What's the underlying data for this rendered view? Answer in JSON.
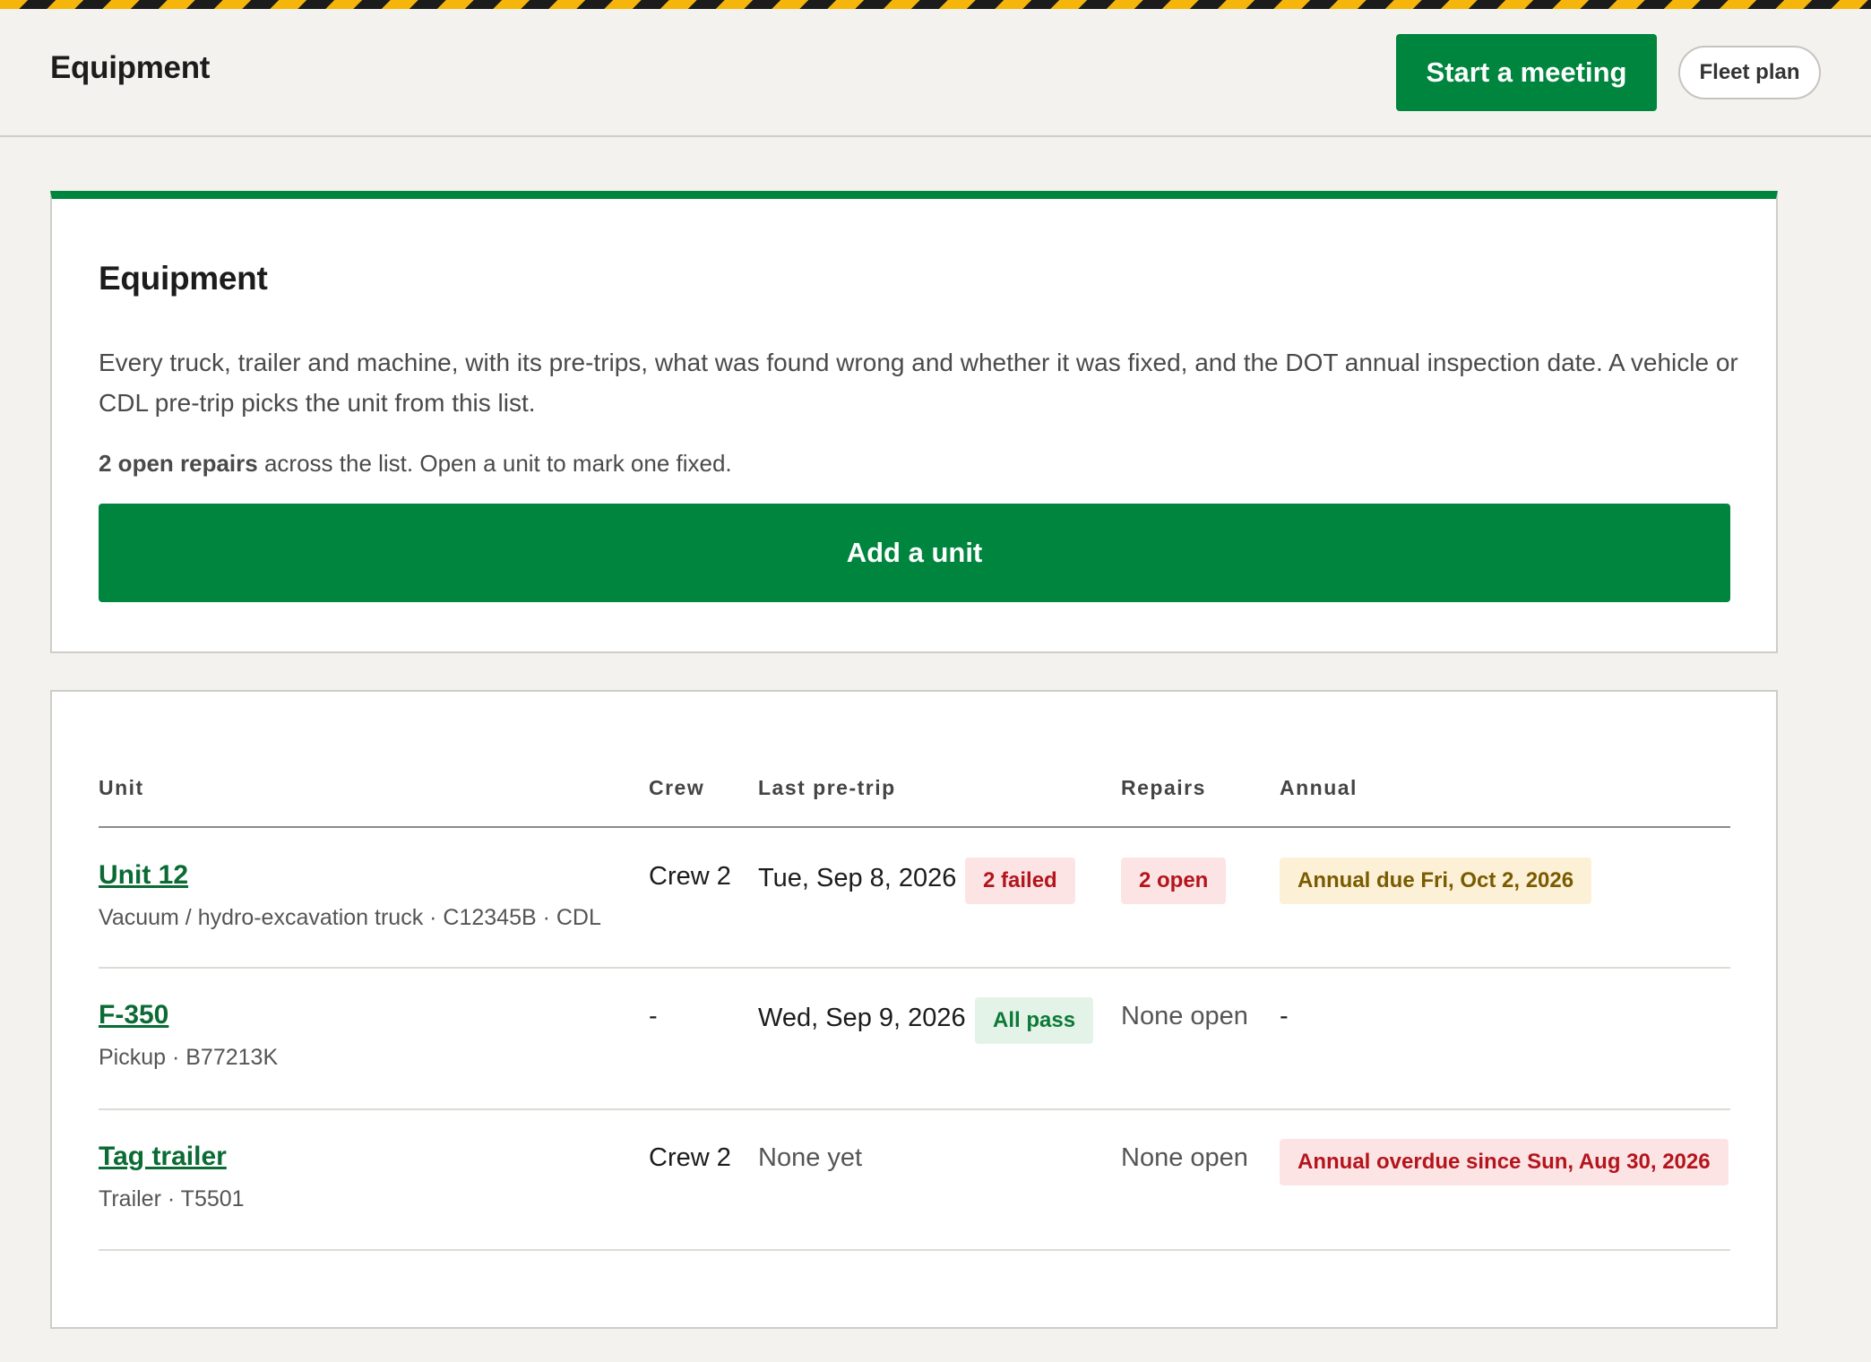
{
  "header": {
    "title": "Equipment",
    "start_meeting_label": "Start a meeting",
    "fleet_plan_label": "Fleet plan"
  },
  "intro": {
    "title": "Equipment",
    "description": "Every truck, trailer and machine, with its pre-trips, what was found wrong and whether it was fixed, and the DOT annual inspection date. A vehicle or CDL pre-trip picks the unit from this list.",
    "repairs_count": "2 open repairs",
    "repairs_note": " across the list. Open a unit to mark one fixed.",
    "add_unit_label": "Add a unit"
  },
  "table": {
    "columns": [
      "Unit",
      "Crew",
      "Last pre-trip",
      "Repairs",
      "Annual"
    ],
    "rows": [
      {
        "unit": "Unit 12",
        "details": "Vacuum / hydro-excavation truck · C12345B · CDL",
        "crew": "Crew 2",
        "last_pretrip": "Tue, Sep 8, 2026",
        "pretrip_badge": "2 failed",
        "repairs": "2 open",
        "annual": "Annual due Fri, Oct 2, 2026"
      },
      {
        "unit": "F-350",
        "details": "Pickup · B77213K",
        "crew": "-",
        "last_pretrip": "Wed, Sep 9, 2026",
        "pretrip_badge": "All pass",
        "repairs": "None open",
        "annual": "-"
      },
      {
        "unit": "Tag trailer",
        "details": "Trailer · T5501",
        "crew": "Crew 2",
        "last_pretrip": "None yet",
        "pretrip_badge": "",
        "repairs": "None open",
        "annual": "Annual overdue since Sun, Aug 30, 2026"
      }
    ]
  },
  "colors": {
    "brand_green": "#00853e",
    "hazard_yellow": "#f5b50a",
    "status_red": "#b4141c",
    "status_green": "#0b7a36",
    "status_amber": "#7a5b00"
  }
}
